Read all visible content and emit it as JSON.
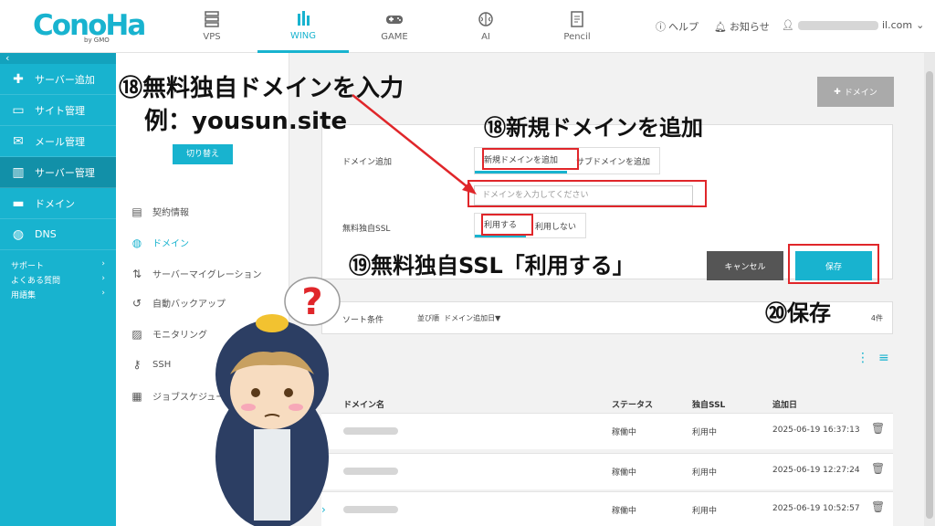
{
  "header": {
    "logo": "ConoHa",
    "logo_by": "by GMO",
    "tabs": [
      {
        "label": "VPS",
        "icon": "server-icon"
      },
      {
        "label": "WING",
        "icon": "wing-icon"
      },
      {
        "label": "GAME",
        "icon": "gamepad-icon"
      },
      {
        "label": "AI",
        "icon": "brain-icon"
      },
      {
        "label": "Pencil",
        "icon": "pencil-icon"
      }
    ],
    "help": "ヘルプ",
    "news": "お知らせ",
    "user_suffix": "il.com"
  },
  "sidebar": {
    "items": [
      {
        "label": "サーバー追加",
        "icon": "plus-icon"
      },
      {
        "label": "サイト管理",
        "icon": "site-icon"
      },
      {
        "label": "メール管理",
        "icon": "mail-icon"
      },
      {
        "label": "サーバー管理",
        "icon": "server-manage-icon"
      },
      {
        "label": "ドメイン",
        "icon": "domain-icon"
      },
      {
        "label": "DNS",
        "icon": "globe-icon"
      }
    ],
    "links": [
      {
        "label": "サポート"
      },
      {
        "label": "よくある質問"
      },
      {
        "label": "用語集"
      }
    ]
  },
  "subpanel": {
    "switch_label": "切り替え",
    "menu": [
      {
        "label": "契約情報",
        "icon": "contract-icon"
      },
      {
        "label": "ドメイン",
        "icon": "globe-icon"
      },
      {
        "label": "サーバーマイグレーション",
        "icon": "migration-icon"
      },
      {
        "label": "自動バックアップ",
        "icon": "backup-icon"
      },
      {
        "label": "モニタリング",
        "icon": "monitoring-icon"
      },
      {
        "label": "SSH",
        "icon": "key-icon"
      },
      {
        "label": "ジョブスケジューラー",
        "icon": "scheduler-icon"
      }
    ]
  },
  "main": {
    "add_domain_button": "ドメイン",
    "form": {
      "domain_add_label": "ドメイン追加",
      "new_domain_option": "新規ドメインを追加",
      "sub_domain_option": "サブドメインを追加",
      "domain_input_placeholder": "ドメインを入力してください",
      "ssl_label": "無料独自SSL",
      "ssl_use": "利用する",
      "ssl_not_use": "利用しない",
      "cancel": "キャンセル",
      "save": "保存"
    },
    "sort": {
      "label": "ソート条件",
      "order_label": "並び順",
      "order_value": "ドメイン追加日▼",
      "count": "4件"
    },
    "table": {
      "headers": [
        "ドメイン名",
        "ステータス",
        "独自SSL",
        "追加日"
      ],
      "rows": [
        {
          "status": "稼働中",
          "ssl": "利用中",
          "date": "2025-06-19 16:37:13"
        },
        {
          "status": "稼働中",
          "ssl": "利用中",
          "date": "2025-06-19 12:27:24"
        },
        {
          "status": "稼働中",
          "ssl": "利用中",
          "date": "2025-06-19 10:52:57"
        }
      ]
    }
  },
  "annotations": {
    "step18_domain": "⑱無料独自ドメインを入力",
    "step18_example": "例：yousun.site",
    "step18_new": "⑱新規ドメインを追加",
    "step19": "⑲無料独自SSL「利用する」",
    "step20": "⑳保存",
    "color": "#e0262a"
  },
  "colors": {
    "accent": "#18b3cf",
    "sidebar_active": "#1290a8"
  }
}
